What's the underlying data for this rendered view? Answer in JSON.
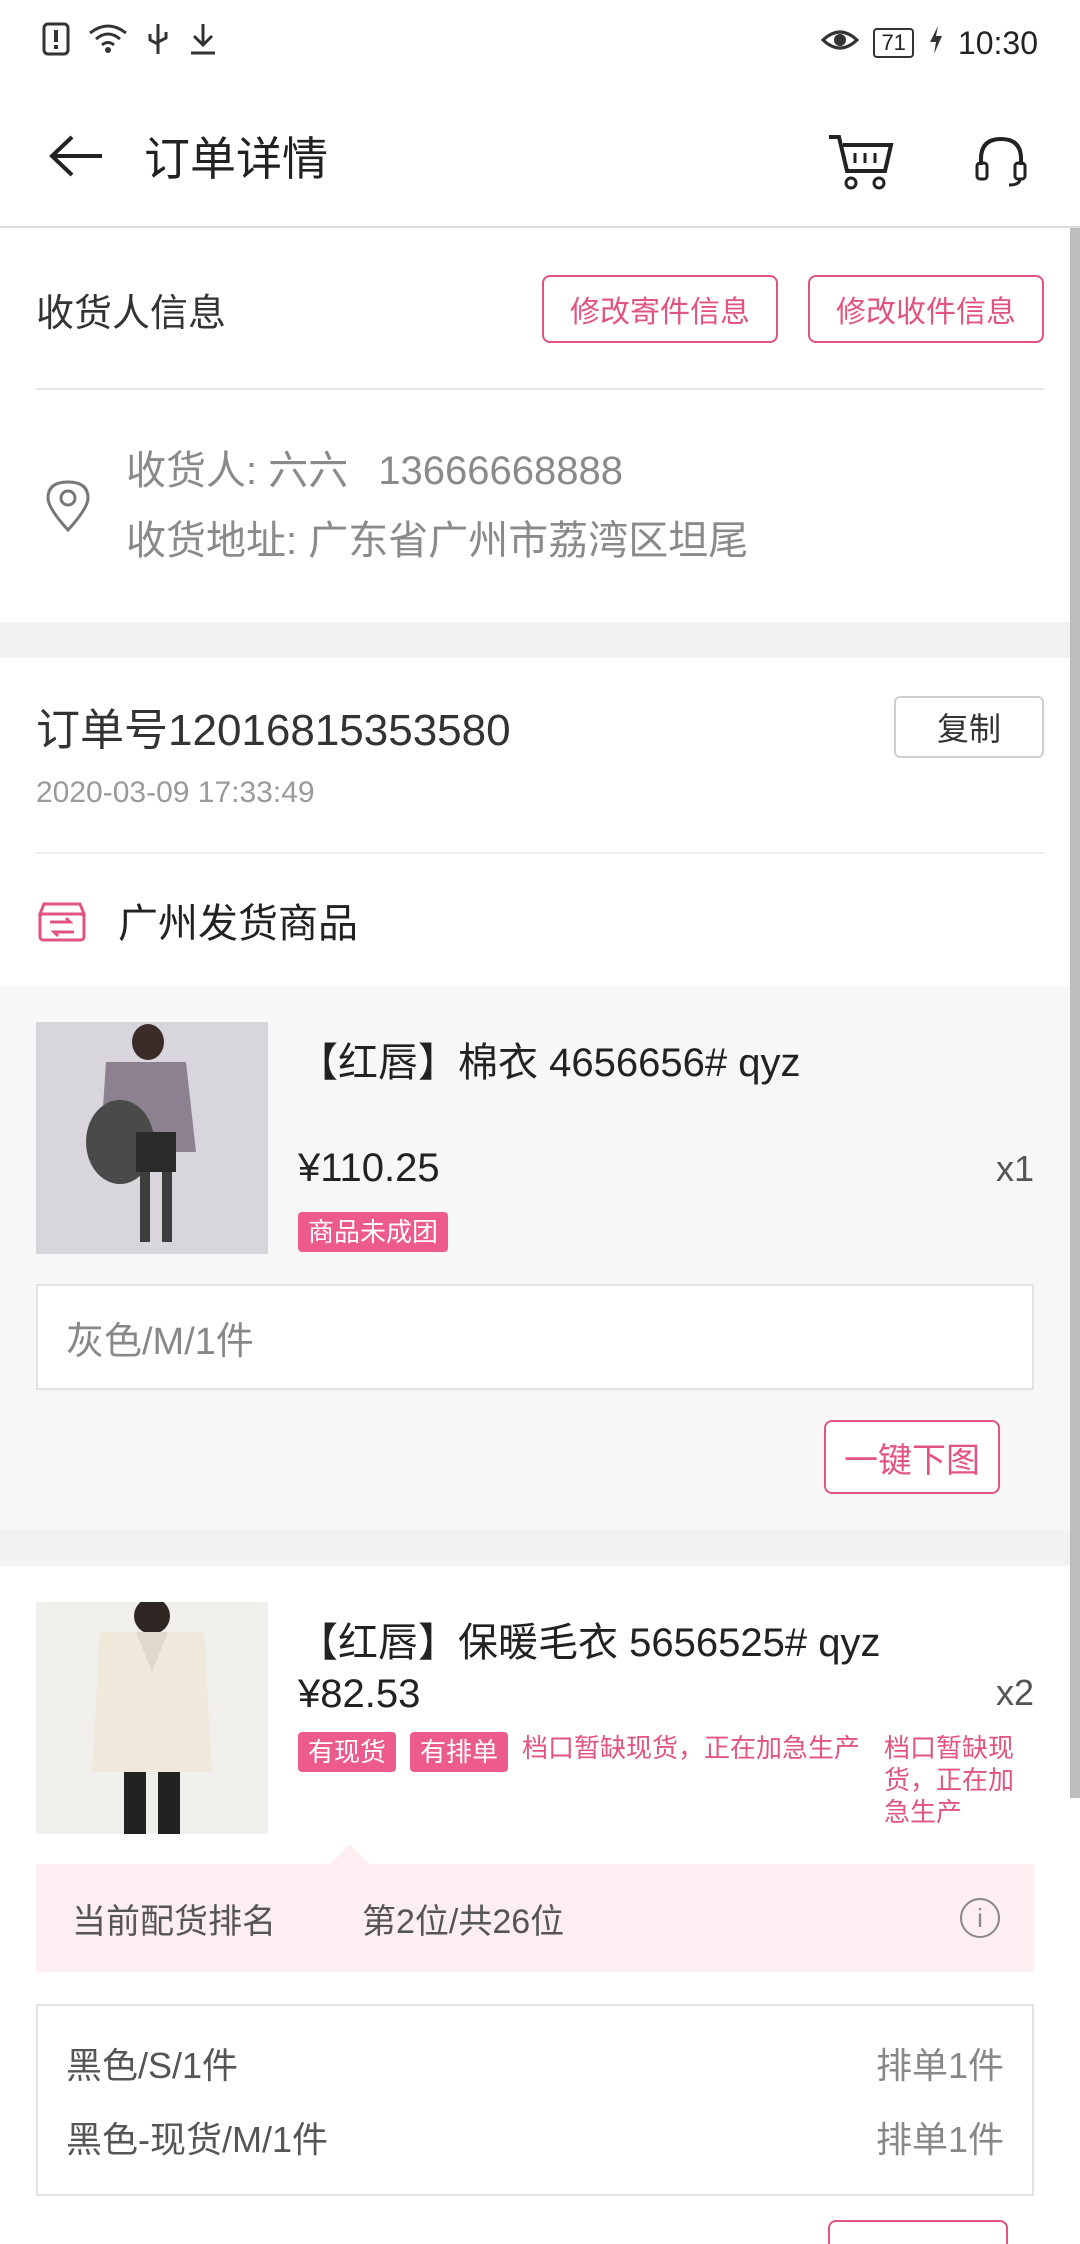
{
  "status_bar": {
    "battery": "71",
    "time": "10:30"
  },
  "nav": {
    "title": "订单详情"
  },
  "recipient": {
    "title": "收货人信息",
    "edit_sender_label": "修改寄件信息",
    "edit_receiver_label": "修改收件信息",
    "name_line": "收货人: 六六",
    "phone": "13666668888",
    "address_line": "收货地址: 广东省广州市荔湾区坦尾"
  },
  "order": {
    "number": "订单号12016815353580",
    "time": "2020-03-09 17:33:49",
    "copy_label": "复制",
    "ship_label": "广州发货商品"
  },
  "products": [
    {
      "name": "【红唇】棉衣  4656656#  qyz",
      "price": "¥110.25",
      "qty": "x1",
      "tag": "商品未成团",
      "spec": "灰色/M/1件",
      "action_label": "一键下图"
    },
    {
      "name": "【红唇】保暖毛衣  5656525#  qyz",
      "price": "¥82.53",
      "qty": "x2",
      "tag1": "有现货",
      "tag2": "有排单",
      "note1": "档口暂缺现货，正在加急生产",
      "note2": "档口暂缺现货，正在加急生产",
      "rank_label": "当前配货排名",
      "rank_value": "第2位/共26位",
      "variants": [
        {
          "left": "黑色/S/1件",
          "right": "排单1件"
        },
        {
          "left": "黑色-现货/M/1件",
          "right": "排单1件"
        }
      ]
    }
  ],
  "colors": {
    "accent": "#e2547f",
    "tag_bg": "#ec5b8b",
    "rank_bg": "#fdeef1"
  }
}
